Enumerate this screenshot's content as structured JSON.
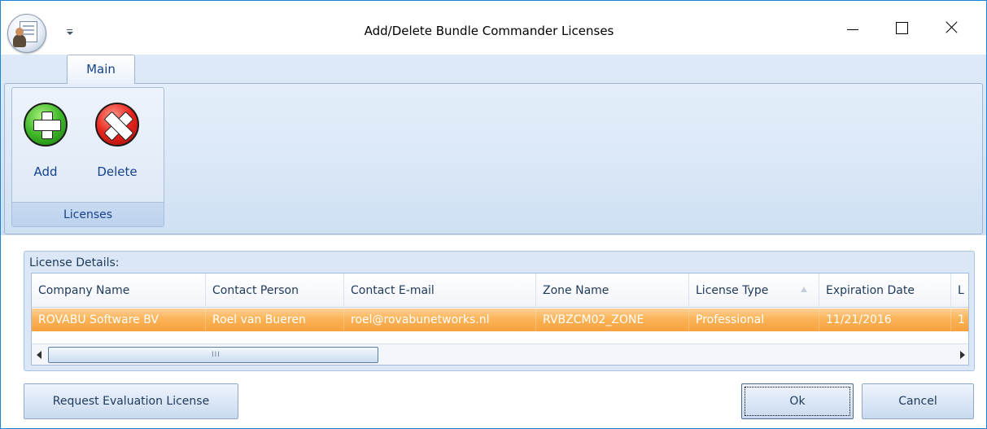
{
  "window": {
    "title": "Add/Delete Bundle Commander Licenses"
  },
  "ribbon": {
    "tabs": [
      {
        "label": "Main",
        "active": true
      }
    ],
    "group": {
      "label": "Licenses",
      "buttons": [
        {
          "label": "Add",
          "icon": "add-icon"
        },
        {
          "label": "Delete",
          "icon": "delete-icon"
        }
      ]
    }
  },
  "details": {
    "label": "License Details:",
    "columns": [
      "Company Name",
      "Contact Person",
      "Contact E-mail",
      "Zone Name",
      "License Type",
      "Expiration Date",
      "L"
    ],
    "sorted_column": "License Type",
    "rows": [
      [
        "ROVABU Software BV",
        "Roel van Bueren",
        "roel@rovabunetworks.nl",
        "RVBZCM02_ZONE",
        "Professional",
        "11/21/2016",
        "1"
      ]
    ],
    "scrollbar_grip": "III"
  },
  "buttons": {
    "request_eval": "Request Evaluation License",
    "ok": "Ok",
    "cancel": "Cancel"
  },
  "colors": {
    "ribbon_bg": "#d0e0f3",
    "row_selected": "#fbb458",
    "text_dark_blue": "#15428b",
    "border_accent": "#1883d7"
  }
}
